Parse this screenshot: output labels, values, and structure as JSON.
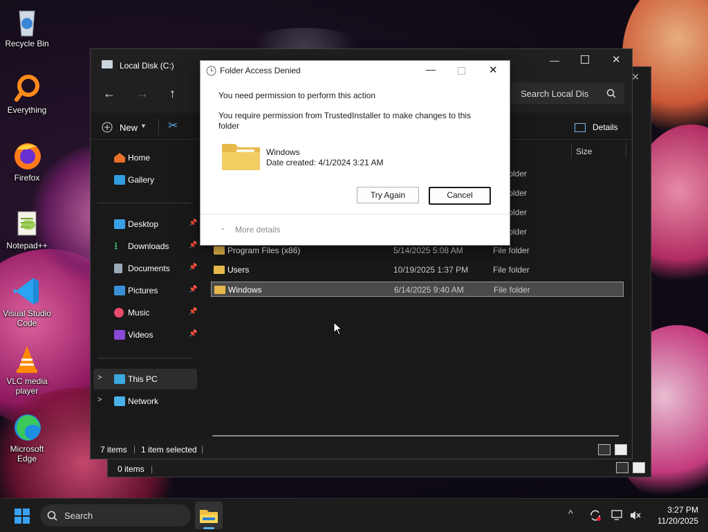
{
  "desktop": {
    "icons": [
      {
        "label": "Recycle Bin"
      },
      {
        "label": "Everything"
      },
      {
        "label": "Firefox"
      },
      {
        "label": "Notepad++"
      },
      {
        "label": "Visual Studio Code"
      },
      {
        "label": "VLC media player"
      },
      {
        "label": "Microsoft Edge"
      }
    ]
  },
  "explorer": {
    "title": "Local Disk (C:)",
    "search_placeholder": "Search Local Dis",
    "new_label": "New",
    "details_label": "Details",
    "size_header": "Size",
    "sidebar": [
      {
        "label": "Home",
        "icon": "home-icon"
      },
      {
        "label": "Gallery",
        "icon": "gallery-icon"
      },
      {
        "label": "Desktop",
        "icon": "desktop-folder-icon",
        "pinned": true
      },
      {
        "label": "Downloads",
        "icon": "downloads-icon",
        "pinned": true
      },
      {
        "label": "Documents",
        "icon": "documents-icon",
        "pinned": true
      },
      {
        "label": "Pictures",
        "icon": "pictures-icon",
        "pinned": true
      },
      {
        "label": "Music",
        "icon": "music-icon",
        "pinned": true
      },
      {
        "label": "Videos",
        "icon": "videos-icon",
        "pinned": true
      },
      {
        "label": "This PC",
        "icon": "this-pc-icon"
      },
      {
        "label": "Network",
        "icon": "network-icon"
      }
    ],
    "partial_types": [
      "folder",
      "folder",
      "folder",
      "folder"
    ],
    "files": [
      {
        "name": "Program Files (x86)",
        "date": "5/14/2025 5:08 AM",
        "type": "File folder"
      },
      {
        "name": "Users",
        "date": "10/19/2025 1:37 PM",
        "type": "File folder"
      },
      {
        "name": "Windows",
        "date": "6/14/2025 9:40 AM",
        "type": "File folder",
        "selected": true
      }
    ],
    "status": {
      "items": "7 items",
      "selected": "1 item selected"
    },
    "back_status": "0 items"
  },
  "dialog": {
    "title": "Folder Access Denied",
    "heading": "You need permission to perform this action",
    "message": "You require permission from TrustedInstaller to make changes to this folder",
    "item_name": "Windows",
    "item_date": "Date created: 4/1/2024 3:21 AM",
    "try_again": "Try Again",
    "cancel": "Cancel",
    "more_details": "More details"
  },
  "taskbar": {
    "search_placeholder": "Search",
    "time": "3:27 PM",
    "date": "11/20/2025"
  },
  "colors": {
    "accent": "#0078d4",
    "folder": "#e7b94a",
    "selection": "#4a4a4a"
  }
}
